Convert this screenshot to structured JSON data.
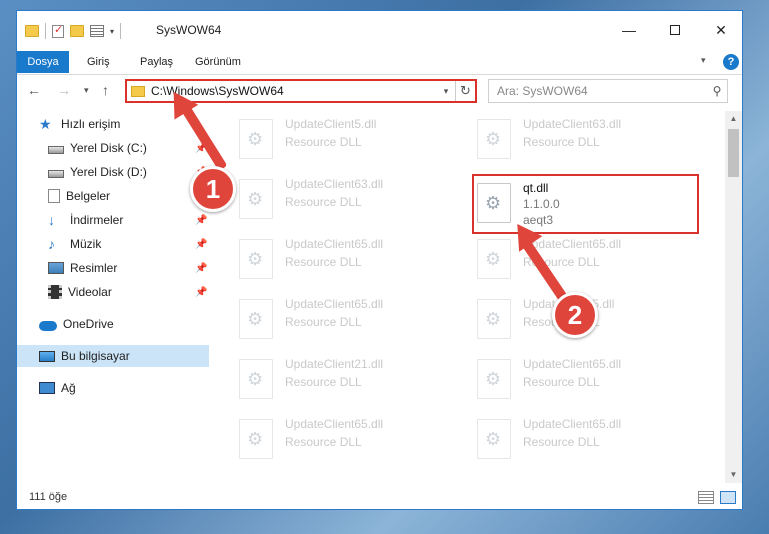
{
  "window": {
    "title": "SysWOW64",
    "minimize_glyph": "—",
    "close_glyph": "✕"
  },
  "ribbon": {
    "tabs": [
      "Dosya",
      "Giriş",
      "Paylaş",
      "Görünüm"
    ],
    "help_label": "?"
  },
  "address": {
    "path": "C:\\Windows\\SysWOW64",
    "search_placeholder": "Ara: SysWOW64"
  },
  "sidebar": {
    "items": [
      {
        "label": "Hızlı erişim",
        "icon": "star-icon"
      },
      {
        "label": "Yerel Disk (C:)",
        "icon": "drive-icon",
        "pinned": true
      },
      {
        "label": "Yerel Disk (D:)",
        "icon": "drive-icon",
        "pinned": true
      },
      {
        "label": "Belgeler",
        "icon": "documents-icon",
        "pinned": true
      },
      {
        "label": "İndirmeler",
        "icon": "downloads-icon",
        "pinned": true
      },
      {
        "label": "Müzik",
        "icon": "music-icon",
        "pinned": true
      },
      {
        "label": "Resimler",
        "icon": "pictures-icon",
        "pinned": true
      },
      {
        "label": "Videolar",
        "icon": "videos-icon",
        "pinned": true
      },
      {
        "label": "OneDrive",
        "icon": "onedrive-icon"
      },
      {
        "label": "Bu bilgisayar",
        "icon": "computer-icon",
        "selected": true
      },
      {
        "label": "Ağ",
        "icon": "network-icon"
      }
    ]
  },
  "files": {
    "left_column": [
      {
        "name": "UpdateClient5.dll",
        "type": "Resource DLL"
      },
      {
        "name": "UpdateClient63.dll",
        "type": "Resource DLL"
      },
      {
        "name": "UpdateClient65.dll",
        "type": "Resource DLL"
      },
      {
        "name": "UpdateClient65.dll",
        "type": "Resource DLL"
      },
      {
        "name": "UpdateClient21.dll",
        "type": "Resource DLL"
      },
      {
        "name": "UpdateClient65.dll",
        "type": "Resource DLL"
      }
    ],
    "right_column": [
      {
        "name": "UpdateClient63.dll",
        "type": "Resource DLL"
      },
      {
        "name": "qt.dll",
        "version": "1.1.0.0",
        "company": "aeqt3",
        "highlighted": true
      },
      {
        "name": "UpdateClient65.dll",
        "type": "Resource DLL"
      },
      {
        "name": "UpdateClient5.dll",
        "type": "Resource DLL"
      },
      {
        "name": "UpdateClient65.dll",
        "type": "Resource DLL"
      },
      {
        "name": "UpdateClient65.dll",
        "type": "Resource DLL"
      }
    ]
  },
  "status": {
    "item_count": "111 öğe"
  },
  "annotations": {
    "badge1": "1",
    "badge2": "2",
    "color": "#e0453c"
  },
  "colors": {
    "accent": "#1979ca",
    "highlight_border": "#d9322b",
    "selected_bg": "#cce4f7"
  }
}
